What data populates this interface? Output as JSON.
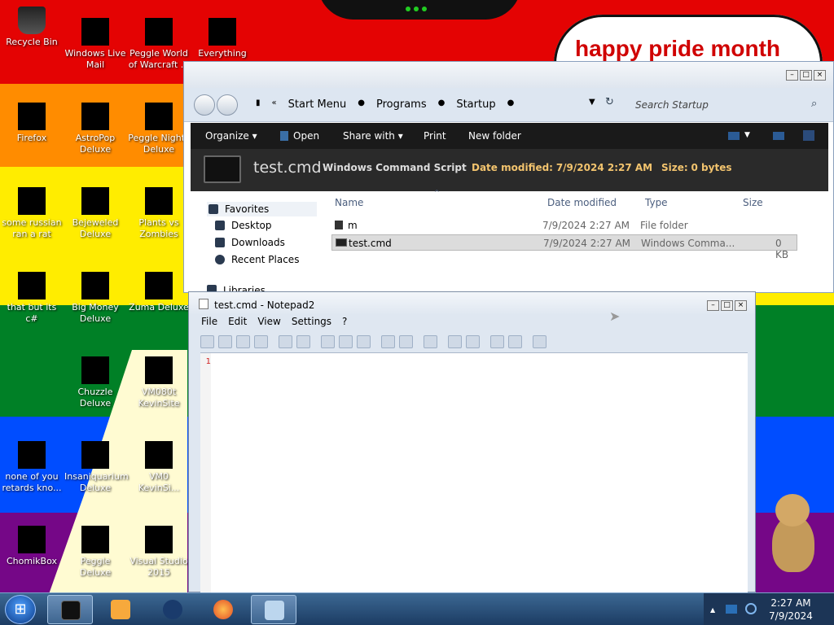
{
  "desktop": {
    "banner": "happy pride month",
    "icons": [
      {
        "label": "Recycle Bin",
        "icon": "recycle-bin-icon"
      },
      {
        "label": "Windows Live Mail",
        "icon": "mail-icon"
      },
      {
        "label": "Peggle World of Warcraft ...",
        "icon": "game-icon"
      },
      {
        "label": "Everything",
        "icon": "search-icon"
      },
      {
        "label": "Firefox",
        "icon": "firefox-icon"
      },
      {
        "label": "AstroPop Deluxe",
        "icon": "game-icon"
      },
      {
        "label": "Peggle Nights Deluxe",
        "icon": "game-icon"
      },
      {
        "label": "some russian ran a rat",
        "icon": "app-icon"
      },
      {
        "label": "Bejeweled Deluxe",
        "icon": "game-icon"
      },
      {
        "label": "Plants vs Zombies",
        "icon": "game-icon"
      },
      {
        "label": "that but its c#",
        "icon": "app-icon"
      },
      {
        "label": "Big Money Deluxe",
        "icon": "game-icon"
      },
      {
        "label": "Zuma Deluxe",
        "icon": "game-icon"
      },
      {
        "label": "Chuzzle Deluxe",
        "icon": "game-icon"
      },
      {
        "label": "VM080t KevinSite",
        "icon": "app-icon"
      },
      {
        "label": "none of you retards kno...",
        "icon": "app-icon"
      },
      {
        "label": "Insaniquarium Deluxe",
        "icon": "game-icon"
      },
      {
        "label": "VM0 KevinSi...",
        "icon": "app-icon"
      },
      {
        "label": "ChomikBox",
        "icon": "app-icon"
      },
      {
        "label": "Peggle Deluxe",
        "icon": "game-icon"
      },
      {
        "label": "Visual Studio 2015",
        "icon": "visual-studio-icon"
      }
    ]
  },
  "explorer": {
    "breadcrumb": [
      "Start Menu",
      "Programs",
      "Startup"
    ],
    "search_placeholder": "Search Startup",
    "toolbar": {
      "organize": "Organize",
      "open": "Open",
      "share": "Share with",
      "print": "Print",
      "new_folder": "New folder"
    },
    "details": {
      "name": "test.cmd",
      "type": "Windows Command Script",
      "date_label": "Date modified:",
      "date_value": "7/9/2024 2:27 AM",
      "size_label": "Size:",
      "size_value": "0 bytes"
    },
    "sidebar": {
      "favorites": "Favorites",
      "items": [
        "Desktop",
        "Downloads",
        "Recent Places"
      ],
      "libraries": "Libraries"
    },
    "columns": [
      "Name",
      "Date modified",
      "Type",
      "Size"
    ],
    "rows": [
      {
        "name": "m",
        "date": "7/9/2024 2:27 AM",
        "type": "File folder",
        "size": ""
      },
      {
        "name": "test.cmd",
        "date": "7/9/2024 2:27 AM",
        "type": "Windows Comma...",
        "size": "0 KB"
      }
    ]
  },
  "notepad": {
    "title": "test.cmd - Notepad2",
    "menu": [
      "File",
      "Edit",
      "View",
      "Settings",
      "?"
    ],
    "line_number": "1"
  },
  "taskbar": {
    "time": "2:27 AM",
    "date": "7/9/2024",
    "start": "start-orb-icon"
  }
}
